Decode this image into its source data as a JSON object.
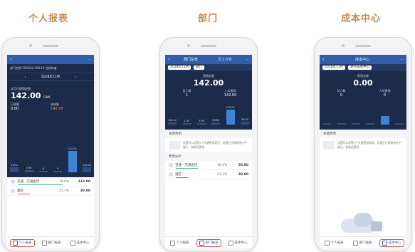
{
  "headings": [
    "个人报表",
    "部门",
    "成本中心"
  ],
  "accent_color": "#2f5fa8",
  "highlight_color": "#d9534f",
  "phone1": {
    "top_line": "部门名称 CNY204,294.10 当前年度",
    "month": "2018年11月",
    "cum_label": "本月已报销金额",
    "cum_value": "142.00",
    "cum_unit": "CNY",
    "left_label": "已结算",
    "left_value": "0.00",
    "right_label": "未结算",
    "right_value": "142.00",
    "bars": [
      {
        "label": "343.1",
        "value": "343.1"
      },
      {
        "label": "3.96",
        "value": "3.96"
      },
      {
        "label": "8",
        "value": "8"
      },
      {
        "label": "9",
        "value": "9"
      },
      {
        "label": "142.00",
        "value": "142.00"
      },
      {
        "label": "142.00",
        "value": "142.00"
      }
    ],
    "bar_levels": [
      0.22,
      0.08,
      0.05,
      0.05,
      0.95,
      0.22
    ],
    "rows": [
      {
        "name": "交通 - 交通出行",
        "pct": "79.0%",
        "amt": "112.00",
        "color": "#4fc08d",
        "level": 0.79
      },
      {
        "name": "酒店",
        "pct": "21.1%",
        "amt": "30.00",
        "color": "#d9534f",
        "level": 0.21
      }
    ],
    "tabs": [
      "个人报表",
      "部门报表",
      "成本中心"
    ],
    "active_tab": 0
  },
  "phone2": {
    "title": "部门总览",
    "tab2": "员工分析",
    "month": "2018年11月",
    "dept": "部门",
    "big_label": "报销金额",
    "big_value": "142.00",
    "left_label": "员人数",
    "left_value": "1",
    "right_label": "人均报销",
    "right_value": "142.00",
    "bar_labels": [
      "343.10",
      "1.45",
      "3.96",
      "26.60",
      "142.00",
      "56.00"
    ],
    "bar_levels": [
      0.15,
      0.06,
      0.08,
      0.12,
      0.95,
      0.18
    ],
    "notice_title": "关键费用",
    "notice_text": "设置可以设置4个关键费用类型，设置后在报表统计中展示，快来设置吧",
    "analysis_title": "费用分析",
    "rows": [
      {
        "name": "交通 - 交通出行",
        "pct": "39.4%",
        "amt": "56.00",
        "color": "#4fc08d",
        "level": 0.39
      },
      {
        "name": "酒店",
        "pct": "21.1%",
        "amt": "30.00",
        "color": "#d9534f",
        "level": 0.21
      }
    ],
    "tabs": [
      "个人报表",
      "部门报表",
      "成本中心"
    ],
    "active_tab": 1
  },
  "phone3": {
    "title": "成本中心",
    "month": "2018年11月",
    "center": "默认成本中心",
    "big_label": "报销金额",
    "big_value": "0.00",
    "left_label": "员人数",
    "left_value": "0",
    "right_label": "人均报销",
    "right_value": "0",
    "bar_levels": [
      0.05,
      0.05,
      0.05,
      0.05,
      0.55,
      0.05
    ],
    "notice_title": "关键费用",
    "notice_text": "设置可以设置4个关键费用类型，设置后在报表统计中展示，快来设置吧",
    "tabs": [
      "个人报表",
      "部门报表",
      "成本中心"
    ],
    "active_tab": 2
  }
}
